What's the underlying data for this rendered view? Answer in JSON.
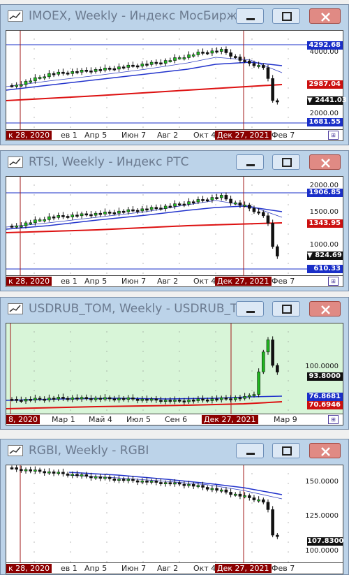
{
  "windows": [
    {
      "title": "IMOEX, Weekly - Индекс МосБиржи",
      "plot_bg": "#ffffff",
      "price_labels": [
        {
          "text": "4292.68",
          "bg": "#1a2fc8"
        },
        {
          "text": "2987.04",
          "bg": "#cc1010"
        },
        {
          "text": "2441.03",
          "bg": "#111111",
          "marker": "▼"
        },
        {
          "text": "1681.55",
          "bg": "#1a2fc8"
        }
      ],
      "axis_labels": [
        "4000.00",
        "2000.00"
      ],
      "x_labels": [
        "к 28, 2020",
        "ев 1",
        "Апр 5",
        "Июн 7",
        "Авг 2",
        "Окт 4",
        "Дек 27, 2021",
        "Фев 7"
      ],
      "x_highlight": [
        0,
        6
      ]
    },
    {
      "title": "RTSI, Weekly - Индекс РТС",
      "plot_bg": "#ffffff",
      "price_labels": [
        {
          "text": "1906.85",
          "bg": "#1a2fc8"
        },
        {
          "text": "1343.95",
          "bg": "#cc1010"
        },
        {
          "text": "824.69",
          "bg": "#111111",
          "marker": "▼"
        },
        {
          "text": "610.33",
          "bg": "#1a2fc8"
        }
      ],
      "axis_labels": [
        "2000.00",
        "1500.00",
        "1000.00"
      ],
      "x_labels": [
        "к 28, 2020",
        "ев 1",
        "Апр 5",
        "Июн 7",
        "Авг 2",
        "Окт 4",
        "Дек 27, 2021",
        "Фев 7"
      ],
      "x_highlight": [
        0,
        6
      ]
    },
    {
      "title": "USDRUB_TOM, Weekly - USDRUB_T...",
      "plot_bg": "#d8f5d8",
      "price_labels": [
        {
          "text": "93.8000",
          "bg": "#111111"
        },
        {
          "text": "76.8681",
          "bg": "#1a2fc8"
        },
        {
          "text": "70.6946",
          "bg": "#cc1010"
        }
      ],
      "axis_labels": [
        "100.0000"
      ],
      "x_labels": [
        "8, 2020",
        "Мар 1",
        "Май 4",
        "Июл 5",
        "Сен 6",
        "Дек 27, 2021",
        "Мар 9"
      ],
      "x_highlight": [
        0,
        5
      ]
    },
    {
      "title": "RGBI, Weekly - RGBI",
      "plot_bg": "#ffffff",
      "price_labels": [
        {
          "text": "107.8300",
          "bg": "#111111"
        }
      ],
      "axis_labels": [
        "150.0000",
        "125.0000",
        "100.0000"
      ],
      "x_labels": [
        "к 28, 2020",
        "ев 1",
        "Апр 5",
        "Июн 7",
        "Авг 2",
        "Окт 4",
        "Дек 27, 2021",
        "Фев 7"
      ],
      "x_highlight": [
        0,
        6
      ]
    }
  ],
  "colors": {
    "bull": "#1fb71f",
    "bear": "#111111",
    "ma_fast": "#2233cc",
    "ma_slow": "#dd1111",
    "vline": "#a01818"
  }
}
